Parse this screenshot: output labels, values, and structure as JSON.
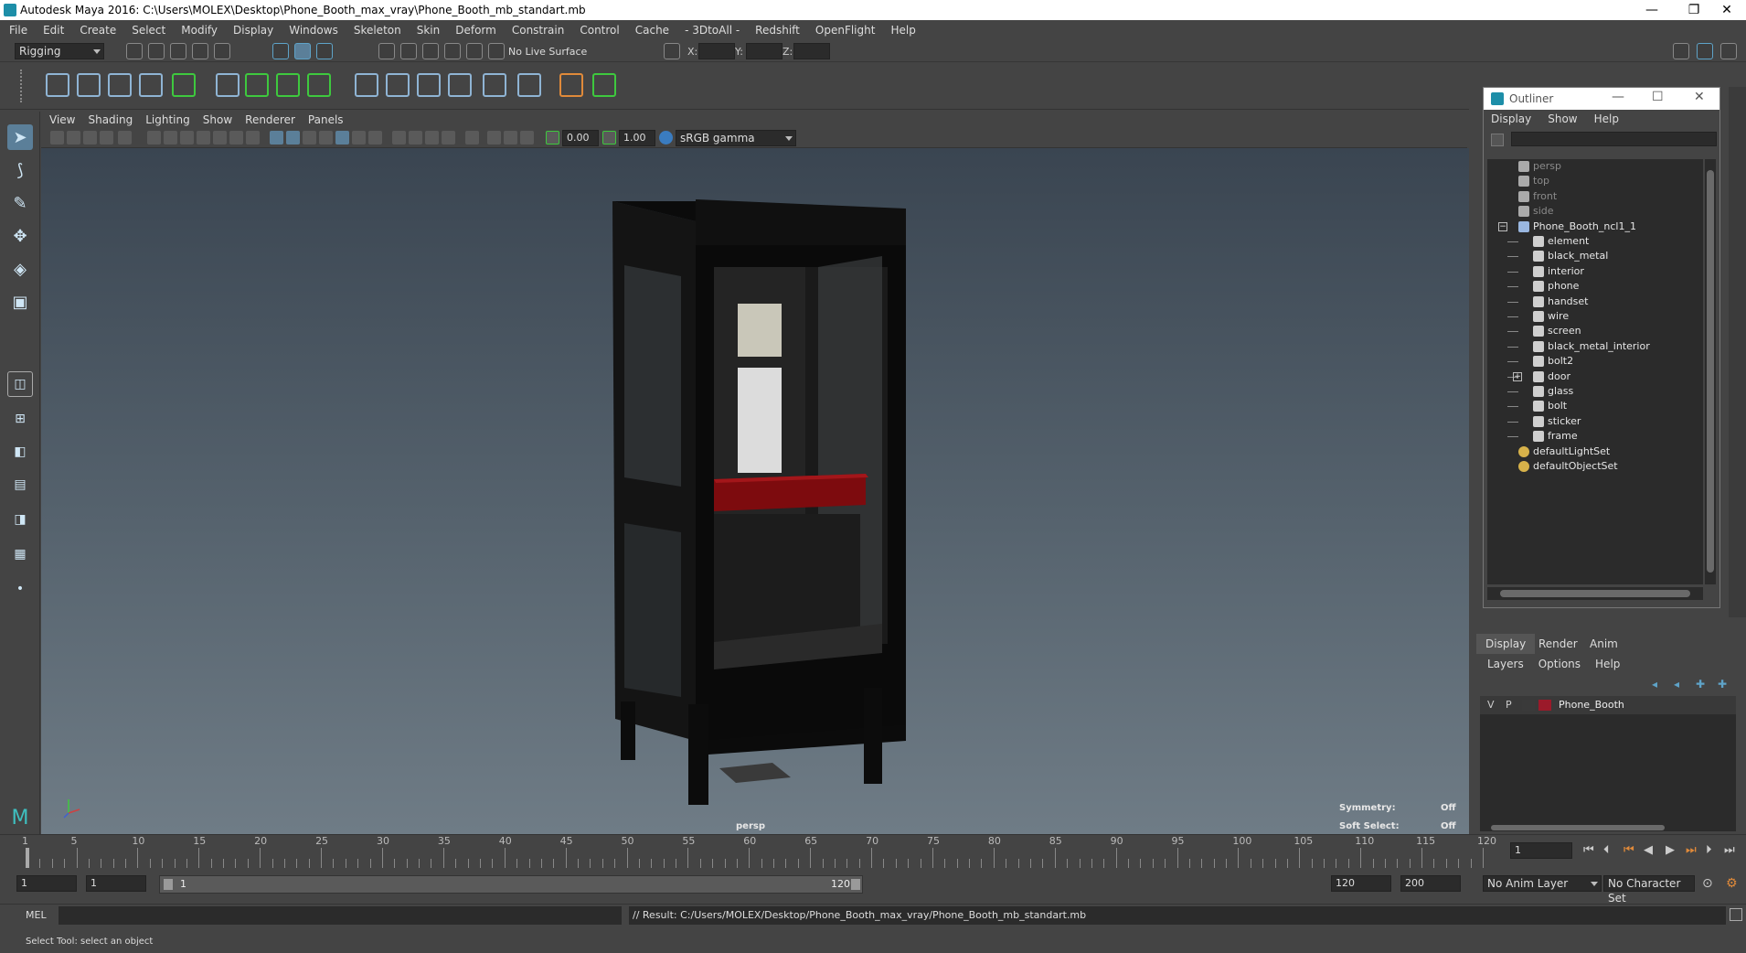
{
  "window": {
    "title": "Autodesk Maya 2016: C:\\Users\\MOLEX\\Desktop\\Phone_Booth_max_vray\\Phone_Booth_mb_standart.mb",
    "minimize": "—",
    "restore": "❐",
    "close": "✕"
  },
  "menubar": [
    "File",
    "Edit",
    "Create",
    "Select",
    "Modify",
    "Display",
    "Windows",
    "Skeleton",
    "Skin",
    "Deform",
    "Constrain",
    "Control",
    "Cache",
    "- 3DtoAll -",
    "Redshift",
    "OpenFlight",
    "Help"
  ],
  "statusline": {
    "menuset": "Rigging",
    "live_surface": "No Live Surface",
    "x_label": "X:",
    "y_label": "Y:",
    "z_label": "Z:"
  },
  "panel": {
    "menus": [
      "View",
      "Shading",
      "Lighting",
      "Show",
      "Renderer",
      "Panels"
    ],
    "exposure": "0.00",
    "gamma": "1.00",
    "color_space": "sRGB gamma"
  },
  "viewport": {
    "camera_label": "persp",
    "symmetry_label": "Symmetry:",
    "symmetry_value": "Off",
    "soft_select_label": "Soft Select:",
    "soft_select_value": "Off"
  },
  "outliner": {
    "title": "Outliner",
    "menus": [
      "Display",
      "Show",
      "Help"
    ],
    "items": [
      {
        "label": "persp",
        "dim": true,
        "indent": 2,
        "icon": "camera-icon"
      },
      {
        "label": "top",
        "dim": true,
        "indent": 2,
        "icon": "camera-icon"
      },
      {
        "label": "front",
        "dim": true,
        "indent": 2,
        "icon": "camera-icon"
      },
      {
        "label": "side",
        "dim": true,
        "indent": 2,
        "icon": "camera-icon"
      },
      {
        "label": "Phone_Booth_ncl1_1",
        "dim": false,
        "indent": 1,
        "icon": "group-icon"
      },
      {
        "label": "element",
        "dim": false,
        "indent": 3,
        "icon": "mesh-icon"
      },
      {
        "label": "black_metal",
        "dim": false,
        "indent": 3,
        "icon": "mesh-icon"
      },
      {
        "label": "interior",
        "dim": false,
        "indent": 3,
        "icon": "mesh-icon"
      },
      {
        "label": "phone",
        "dim": false,
        "indent": 3,
        "icon": "mesh-icon"
      },
      {
        "label": "handset",
        "dim": false,
        "indent": 3,
        "icon": "mesh-icon"
      },
      {
        "label": "wire",
        "dim": false,
        "indent": 3,
        "icon": "mesh-icon"
      },
      {
        "label": "screen",
        "dim": false,
        "indent": 3,
        "icon": "mesh-icon"
      },
      {
        "label": "black_metal_interior",
        "dim": false,
        "indent": 3,
        "icon": "mesh-icon"
      },
      {
        "label": "bolt2",
        "dim": false,
        "indent": 3,
        "icon": "mesh-icon"
      },
      {
        "label": "door",
        "dim": false,
        "indent": 3,
        "icon": "mesh-icon"
      },
      {
        "label": "glass",
        "dim": false,
        "indent": 3,
        "icon": "mesh-icon"
      },
      {
        "label": "bolt",
        "dim": false,
        "indent": 3,
        "icon": "mesh-icon"
      },
      {
        "label": "sticker",
        "dim": false,
        "indent": 3,
        "icon": "mesh-icon"
      },
      {
        "label": "frame",
        "dim": false,
        "indent": 3,
        "icon": "mesh-icon"
      },
      {
        "label": "defaultLightSet",
        "dim": false,
        "indent": 1,
        "icon": "set-icon"
      },
      {
        "label": "defaultObjectSet",
        "dim": false,
        "indent": 1,
        "icon": "set-icon"
      }
    ]
  },
  "layers": {
    "tabs": [
      "Display",
      "Render",
      "Anim"
    ],
    "menus": [
      "Layers",
      "Options",
      "Help"
    ],
    "row": {
      "v": "V",
      "p": "P",
      "name": "Phone_Booth",
      "color": "#9b1a2a"
    }
  },
  "timeline": {
    "ticks": [
      1,
      5,
      10,
      15,
      20,
      25,
      30,
      35,
      40,
      45,
      50,
      55,
      60,
      65,
      70,
      75,
      80,
      85,
      90,
      95,
      100,
      105,
      110,
      115,
      120
    ],
    "current_frame": "1"
  },
  "range": {
    "start": "1",
    "playback_start": "1",
    "slider_start": "1",
    "slider_end": "120",
    "playback_end": "120",
    "end": "200",
    "anim_layer": "No Anim Layer",
    "character_set": "No Character Set"
  },
  "command": {
    "lang": "MEL",
    "result": "// Result: C:/Users/MOLEX/Desktop/Phone_Booth_max_vray/Phone_Booth_mb_standart.mb"
  },
  "help_line": "Select Tool: select an object",
  "colors": {
    "accent": "#5ea3c8",
    "shelf_green": "#3ec93e",
    "red_band": "#8b0d10",
    "layer_color": "#9b1a2a"
  }
}
